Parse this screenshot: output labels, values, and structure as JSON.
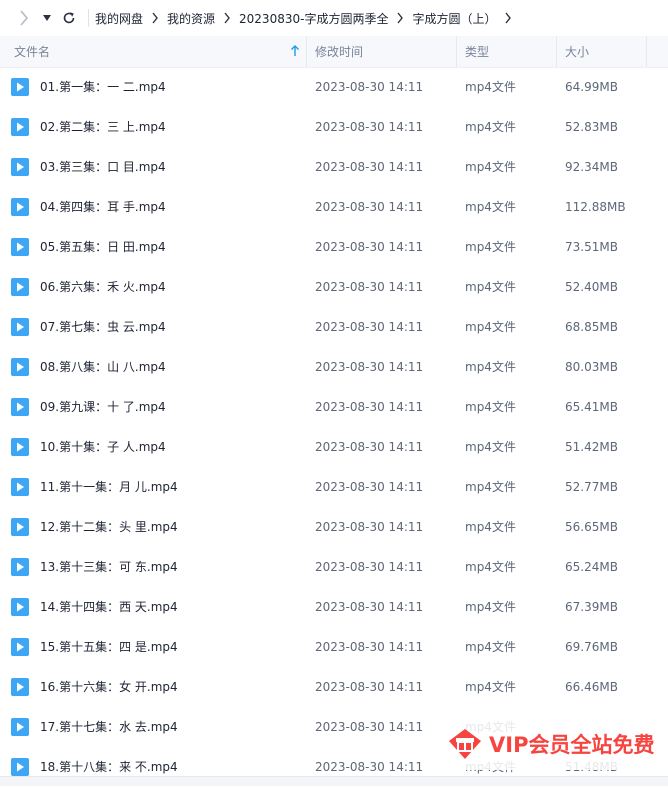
{
  "toolbar": {
    "breadcrumbs": [
      "我的网盘",
      "我的资源",
      "20230830-字成方圆两季全",
      "字成方圆（上）"
    ]
  },
  "columns": {
    "name": "文件名",
    "mtime": "修改时间",
    "type": "类型",
    "size": "大小"
  },
  "files": [
    {
      "name": "01.第一集：一 二.mp4",
      "mtime": "2023-08-30 14:11",
      "type": "mp4文件",
      "size": "64.99MB"
    },
    {
      "name": "02.第二集：三 上.mp4",
      "mtime": "2023-08-30 14:11",
      "type": "mp4文件",
      "size": "52.83MB"
    },
    {
      "name": "03.第三集：口 目.mp4",
      "mtime": "2023-08-30 14:11",
      "type": "mp4文件",
      "size": "92.34MB"
    },
    {
      "name": "04.第四集：耳 手.mp4",
      "mtime": "2023-08-30 14:11",
      "type": "mp4文件",
      "size": "112.88MB"
    },
    {
      "name": "05.第五集：日 田.mp4",
      "mtime": "2023-08-30 14:11",
      "type": "mp4文件",
      "size": "73.51MB"
    },
    {
      "name": "06.第六集：禾 火.mp4",
      "mtime": "2023-08-30 14:11",
      "type": "mp4文件",
      "size": "52.40MB"
    },
    {
      "name": "07.第七集：虫 云.mp4",
      "mtime": "2023-08-30 14:11",
      "type": "mp4文件",
      "size": "68.85MB"
    },
    {
      "name": "08.第八集：山 八.mp4",
      "mtime": "2023-08-30 14:11",
      "type": "mp4文件",
      "size": "80.03MB"
    },
    {
      "name": "09.第九课：十 了.mp4",
      "mtime": "2023-08-30 14:11",
      "type": "mp4文件",
      "size": "65.41MB"
    },
    {
      "name": "10.第十集：子 人.mp4",
      "mtime": "2023-08-30 14:11",
      "type": "mp4文件",
      "size": "51.42MB"
    },
    {
      "name": "11.第十一集：月 儿.mp4",
      "mtime": "2023-08-30 14:11",
      "type": "mp4文件",
      "size": "52.77MB"
    },
    {
      "name": "12.第十二集：头 里.mp4",
      "mtime": "2023-08-30 14:11",
      "type": "mp4文件",
      "size": "56.65MB"
    },
    {
      "name": "13.第十三集：可 东.mp4",
      "mtime": "2023-08-30 14:11",
      "type": "mp4文件",
      "size": "65.24MB"
    },
    {
      "name": "14.第十四集：西 天.mp4",
      "mtime": "2023-08-30 14:11",
      "type": "mp4文件",
      "size": "67.39MB"
    },
    {
      "name": "15.第十五集：四 是.mp4",
      "mtime": "2023-08-30 14:11",
      "type": "mp4文件",
      "size": "69.76MB"
    },
    {
      "name": "16.第十六集：女 开.mp4",
      "mtime": "2023-08-30 14:11",
      "type": "mp4文件",
      "size": "66.46MB"
    },
    {
      "name": "17.第十七集：水 去.mp4",
      "mtime": "2023-08-30 14:11",
      "type": "mp4文件",
      "size": ""
    },
    {
      "name": "18.第十八集：来 不.mp4",
      "mtime": "2023-08-30 14:11",
      "type": "mp4文件",
      "size": "51.48MB"
    }
  ],
  "badge": {
    "text": "VIP会员全站免费"
  },
  "colors": {
    "accent": "#1e9bf0",
    "file_icon": "#3da7f5",
    "badge_red": "#f7443f"
  },
  "icons": {
    "back": "chevron-right-icon",
    "dropdown": "caret-down-icon",
    "refresh": "refresh-icon",
    "crumb_separator": "chevron-right-icon",
    "sort": "arrow-up-icon",
    "file": "video-file-icon",
    "badge": "gift-icon"
  }
}
